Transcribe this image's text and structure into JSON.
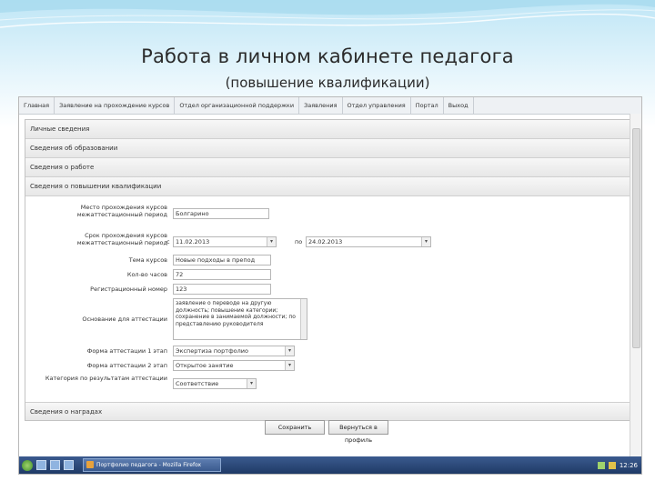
{
  "slide": {
    "title": "Работа в личном кабинете педагога",
    "subtitle": "(повышение квалификации)"
  },
  "menu": [
    "Главная",
    "Заявление на прохождение курсов",
    "Отдел организационной поддержки",
    "Заявления",
    "Отдел управления",
    "Портал",
    "Выход"
  ],
  "sections": {
    "personal": "Личные сведения",
    "education": "Сведения об образовании",
    "work": "Сведения о работе",
    "qualification": "Сведения о повышении квалификации",
    "awards": "Сведения о наградах"
  },
  "form": {
    "place_label": "Место прохождения курсов межаттестационный период",
    "place_value": "Болгарино",
    "period_label": "Срок прохождения курсов межаттестационный период",
    "period_from_prefix": "с",
    "period_from": "11.02.2013",
    "period_to_prefix": "по",
    "period_to": "24.02.2013",
    "topic_label": "Тема курсов",
    "topic_value": "Новые подходы в препод",
    "hours_label": "Кол-во часов",
    "hours_value": "72",
    "cert_label": "Регистрационный номер",
    "cert_value": "123",
    "basis_label": "Основание для аттестации",
    "basis_value": "заявление о переводе на другую должность; повышение категории; сохранение в занимаемой должности; по представлению руководителя",
    "form1_label": "Форма аттестации 1 этап",
    "form1_value": "Экспертиза портфолио",
    "form2_label": "Форма аттестации 2 этап",
    "form2_value": "Открытое занятие",
    "category_label": "Категория по результатам аттестации",
    "category_value": "Соответствие"
  },
  "buttons": {
    "save": "Сохранить",
    "back": "Вернуться в профиль"
  },
  "taskbar": {
    "task": "Портфолио педагога - Mozilla Firefox",
    "clock": "12:26"
  }
}
